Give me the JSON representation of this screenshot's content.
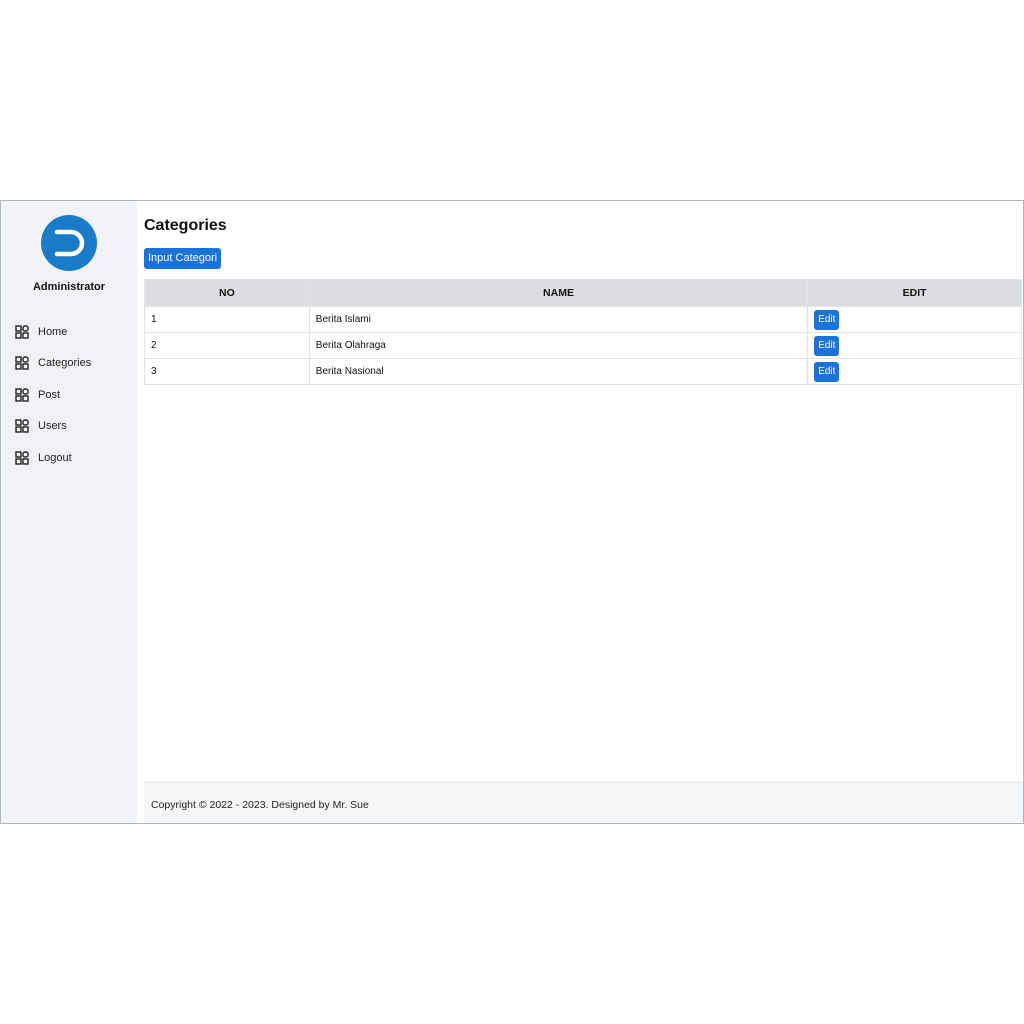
{
  "sidebar": {
    "logo_icon": "d-logo-icon",
    "user_name": "Administrator",
    "items": [
      {
        "label": "Home",
        "icon": "grid-icon"
      },
      {
        "label": "Categories",
        "icon": "grid-icon"
      },
      {
        "label": "Post",
        "icon": "grid-icon"
      },
      {
        "label": "Users",
        "icon": "grid-icon"
      },
      {
        "label": "Logout",
        "icon": "grid-icon"
      }
    ]
  },
  "main": {
    "title": "Categories",
    "input_button_label": "Input Categori",
    "table": {
      "headers": [
        "NO",
        "NAME",
        "EDIT"
      ],
      "rows": [
        {
          "no": "1",
          "name": "Berita Islami",
          "edit_label": "Edit"
        },
        {
          "no": "2",
          "name": "Berita Olahraga",
          "edit_label": "Edit"
        },
        {
          "no": "3",
          "name": "Berita Nasional",
          "edit_label": "Edit"
        }
      ]
    }
  },
  "footer": {
    "text": "Copyright © 2022 - 2023. Designed by Mr. Sue"
  },
  "colors": {
    "brand": "#1a7cc9",
    "button": "#1a73d9",
    "sidebar_bg": "#f1f2f6",
    "table_header_bg": "#dcdde0"
  }
}
